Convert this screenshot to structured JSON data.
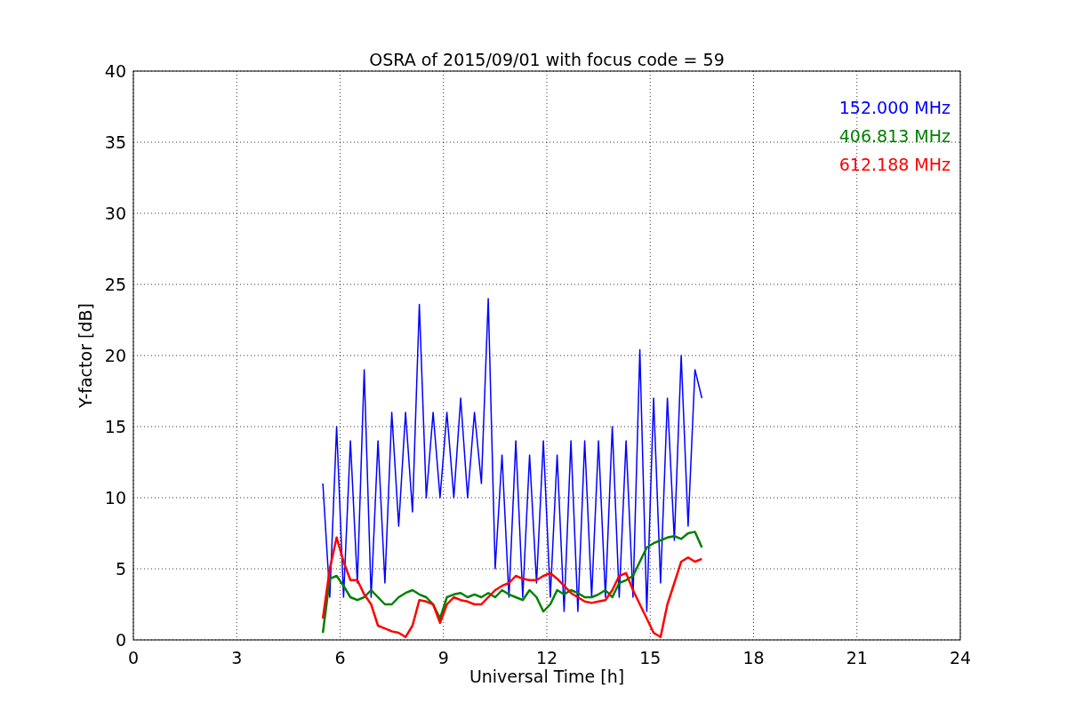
{
  "chart_data": {
    "type": "line",
    "grid": true,
    "title": "OSRA of 2015/09/01 with focus code = 59",
    "xlabel": "Universal Time [h]",
    "ylabel": "Y-factor [dB]",
    "xlim": [
      0,
      24
    ],
    "ylim": [
      0,
      40
    ],
    "xticks": [
      0,
      3,
      6,
      9,
      12,
      15,
      18,
      21,
      24
    ],
    "yticks": [
      0,
      5,
      10,
      15,
      20,
      25,
      30,
      35,
      40
    ],
    "x": [
      5.5,
      5.7,
      5.9,
      6.1,
      6.3,
      6.5,
      6.7,
      6.9,
      7.1,
      7.3,
      7.5,
      7.7,
      7.9,
      8.1,
      8.3,
      8.5,
      8.7,
      8.9,
      9.1,
      9.3,
      9.5,
      9.7,
      9.9,
      10.1,
      10.3,
      10.5,
      10.7,
      10.9,
      11.1,
      11.3,
      11.5,
      11.7,
      11.9,
      12.1,
      12.3,
      12.5,
      12.7,
      12.9,
      13.1,
      13.3,
      13.5,
      13.7,
      13.9,
      14.1,
      14.3,
      14.5,
      14.7,
      14.9,
      15.1,
      15.3,
      15.5,
      15.7,
      15.9,
      16.1,
      16.3,
      16.5
    ],
    "series": [
      {
        "name": "152.000 MHz",
        "color": "#0000ff",
        "values": [
          11,
          3,
          15,
          3,
          14,
          4,
          19,
          3,
          14,
          4,
          16,
          8,
          16,
          9,
          23.6,
          10,
          16,
          10,
          16,
          10,
          17,
          10,
          16,
          11,
          24,
          5,
          13,
          3,
          14,
          3,
          13,
          4,
          14,
          3,
          13,
          2,
          14,
          2,
          14,
          3,
          14,
          3,
          15,
          3,
          14,
          3,
          20.4,
          2,
          17,
          4,
          17,
          7,
          20,
          8,
          19,
          17
        ]
      },
      {
        "name": "406.813 MHz",
        "color": "#008000",
        "values": [
          0.5,
          4.3,
          4.5,
          3.8,
          3,
          2.8,
          3,
          3.5,
          3,
          2.5,
          2.5,
          3,
          3.3,
          3.5,
          3.2,
          3,
          2.5,
          1.5,
          3,
          3.2,
          3.3,
          3,
          3.2,
          3,
          3.3,
          3,
          3.5,
          3.2,
          3,
          2.8,
          3.5,
          3,
          2,
          2.5,
          3.5,
          3.2,
          3.5,
          3.3,
          3,
          3,
          3.2,
          3.5,
          3,
          4,
          4.2,
          4.5,
          5.5,
          6.5,
          6.8,
          7,
          7.2,
          7.3,
          7.1,
          7.5,
          7.6,
          6.5
        ]
      },
      {
        "name": "612.188 MHz",
        "color": "#ff0000",
        "values": [
          1.5,
          5,
          7.2,
          5.5,
          4.2,
          4.2,
          3.2,
          2.5,
          1,
          0.8,
          0.6,
          0.5,
          0.2,
          1,
          2.8,
          2.7,
          2.5,
          1.2,
          2.5,
          3,
          2.8,
          2.7,
          2.5,
          2.5,
          3,
          3.5,
          3.8,
          4,
          4.5,
          4.3,
          4.2,
          4.2,
          4.5,
          4.7,
          4.3,
          3.8,
          3.3,
          3,
          2.7,
          2.6,
          2.7,
          2.8,
          3.5,
          4.5,
          4.7,
          3.5,
          2.5,
          1.5,
          0.5,
          0.2,
          2.5,
          4,
          5.5,
          5.8,
          5.5,
          5.7
        ]
      }
    ]
  }
}
